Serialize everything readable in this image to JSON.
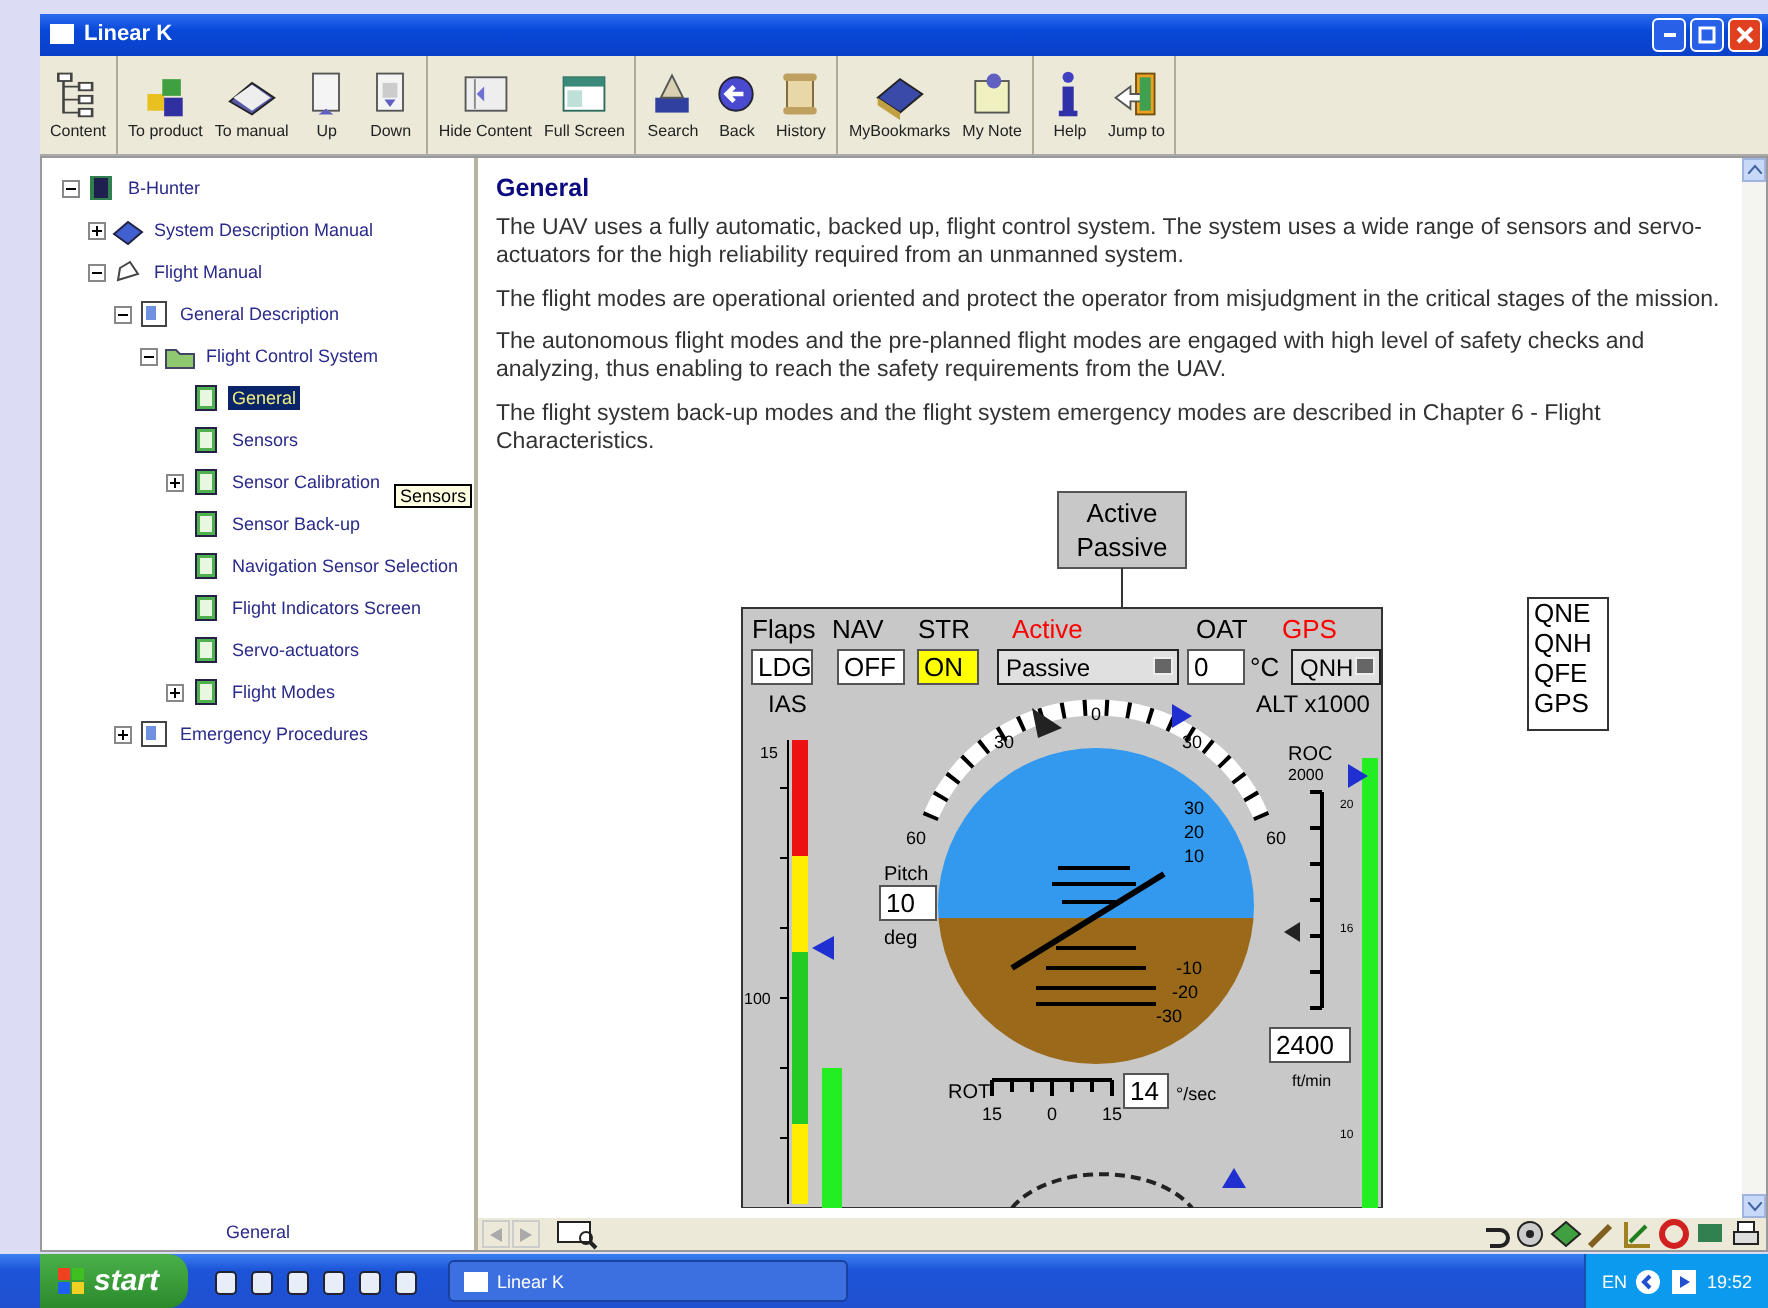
{
  "window": {
    "title": "Linear K"
  },
  "toolbar": {
    "groups": [
      [
        {
          "label": "Content"
        }
      ],
      [
        {
          "label": "To product"
        },
        {
          "label": "To manual"
        },
        {
          "label": "Up"
        },
        {
          "label": "Down"
        }
      ],
      [
        {
          "label": "Hide Content"
        },
        {
          "label": "Full Screen"
        }
      ],
      [
        {
          "label": "Search"
        },
        {
          "label": "Back"
        },
        {
          "label": "History"
        }
      ],
      [
        {
          "label": "MyBookmarks"
        },
        {
          "label": "My Note"
        }
      ],
      [
        {
          "label": "Help"
        },
        {
          "label": "Jump to"
        }
      ]
    ]
  },
  "tree": {
    "items": [
      {
        "label": "B-Hunter",
        "kind": "product",
        "expanded": true,
        "selected": false,
        "children": [
          {
            "label": "System Description Manual",
            "kind": "manual",
            "expanded": false,
            "selected": false
          },
          {
            "label": "Flight Manual",
            "kind": "flight",
            "expanded": true,
            "selected": false,
            "children": [
              {
                "label": "General Description",
                "kind": "chapter",
                "expanded": true,
                "selected": false,
                "children": [
                  {
                    "label": "Flight Control System",
                    "kind": "folder",
                    "expanded": true,
                    "selected": false,
                    "children": [
                      {
                        "label": "General",
                        "kind": "page",
                        "selected": true
                      },
                      {
                        "label": "Sensors",
                        "kind": "page",
                        "selected": false
                      },
                      {
                        "label": "Sensor Calibration",
                        "kind": "page",
                        "expanded": false,
                        "selected": false,
                        "tooltip": "Sensors"
                      },
                      {
                        "label": "Sensor Back-up",
                        "kind": "page",
                        "selected": false
                      },
                      {
                        "label": "Navigation Sensor Selection",
                        "kind": "page",
                        "selected": false
                      },
                      {
                        "label": "Flight Indicators Screen",
                        "kind": "page",
                        "selected": false
                      },
                      {
                        "label": "Servo-actuators",
                        "kind": "page",
                        "selected": false
                      },
                      {
                        "label": "Flight Modes",
                        "kind": "page",
                        "expanded": false,
                        "selected": false
                      }
                    ]
                  }
                ]
              },
              {
                "label": "Emergency Procedures",
                "kind": "chapter",
                "expanded": false,
                "selected": false
              }
            ]
          }
        ]
      }
    ]
  },
  "content": {
    "heading": "General",
    "paragraphs": [
      "The UAV uses a fully automatic, backed up, flight control system. The system uses a wide range of sensors and servo-actuators for the high reliability required from an unmanned system.",
      "The flight modes are operational oriented and protect the operator from misjudgment in the critical stages of the mission.",
      "The autonomous flight modes and the pre-planned flight modes are engaged with high level of safety checks and analyzing, thus enabling to reach the safety requirements from the UAV.",
      "The flight system back-up modes and the flight system emergency modes are described in Chapter 6 - Flight Characteristics."
    ]
  },
  "diagram": {
    "callout": [
      "Active",
      "Passive"
    ],
    "header": [
      {
        "label": "Flaps",
        "value": "LDG",
        "kind": "field",
        "color": "#000000",
        "on": false
      },
      {
        "label": "NAV",
        "value": "OFF",
        "kind": "field",
        "color": "#000000",
        "on": false
      },
      {
        "label": "STR",
        "value": "ON",
        "kind": "field",
        "color": "#000000",
        "on": true
      },
      {
        "label": "Active",
        "value": "Passive",
        "kind": "dropdown",
        "color": "#ff0000",
        "on": false
      },
      {
        "label": "OAT",
        "value": "0",
        "unit": "°C",
        "kind": "field",
        "color": "#000000",
        "on": false
      },
      {
        "label": "GPS",
        "value": "QNH",
        "kind": "dropdown",
        "color": "#ff0000",
        "on": false
      }
    ],
    "gps_options": [
      "QNE",
      "QNH",
      "QFE",
      "GPS"
    ],
    "ias_label": "IAS",
    "ias_ticks": [
      "15",
      "100"
    ],
    "alt_label": "ALT x1000",
    "alt_ticks": [
      "20",
      "16",
      "10"
    ],
    "roll_ticks": [
      "0",
      "30",
      "30",
      "60",
      "60"
    ],
    "pitch_ticks": [
      "30",
      "20",
      "10",
      "-10",
      "-20",
      "-30"
    ],
    "pitch": {
      "label": "Pitch",
      "value": "10",
      "unit": "deg"
    },
    "roc": {
      "label": "ROC",
      "scale": "2000",
      "value": "2400",
      "unit": "ft/min"
    },
    "rot": {
      "label": "ROT",
      "ticks": [
        "15",
        "0",
        "15"
      ],
      "value": "14",
      "unit": "°/sec"
    }
  },
  "bottom_bar": {
    "tab": "General"
  },
  "taskbar": {
    "start": "start",
    "task": "Linear K",
    "language": "EN",
    "time": "19:52"
  }
}
